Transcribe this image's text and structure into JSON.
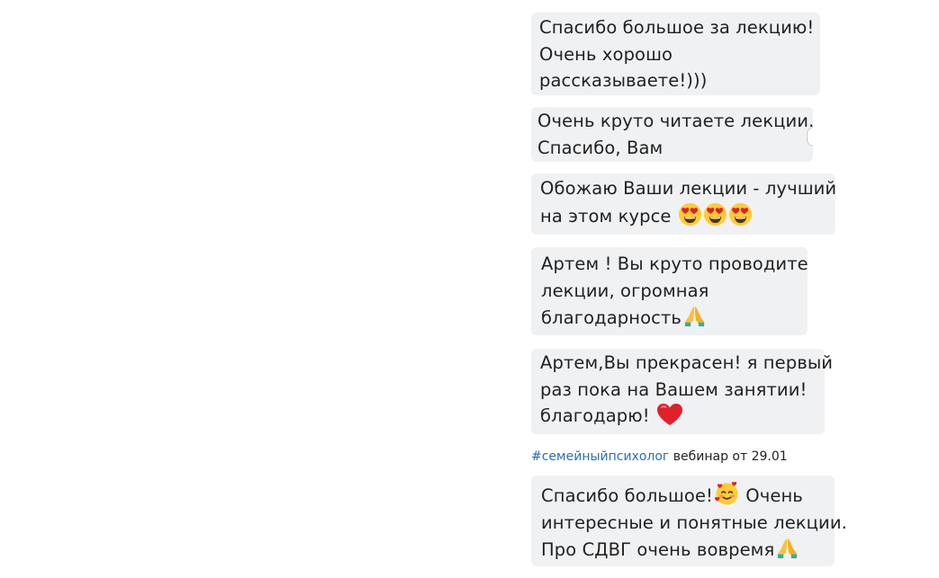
{
  "messages": [
    {
      "lines": [
        "Спасибо большое за лекцию!",
        "Очень хорошо",
        "рассказываете!)))"
      ]
    },
    {
      "lines": [
        "Очень круто читаете лекции.",
        "Спасибо, Вам"
      ]
    },
    {
      "lines": [
        "Обожаю Ваши лекции - лучший",
        "на этом курсе"
      ],
      "emoji": [
        "heart-eyes-icon",
        "heart-eyes-icon",
        "heart-eyes-icon"
      ]
    },
    {
      "lines": [
        "Артем !  Вы круто проводите",
        "лекции, огромная",
        "благодарность"
      ],
      "emoji": [
        "folded-hands-icon"
      ]
    },
    {
      "lines": [
        "Артем,Вы прекрасен! я первый",
        "раз пока на Вашем занятии!",
        "благодарю!"
      ],
      "emoji": [
        "red-heart-icon"
      ]
    },
    {
      "lines": [
        "Спасибо большое!",
        "Очень",
        "интересные и понятные лекции.",
        "Про СДВГ очень вовремя"
      ],
      "emoji": [
        "smiling-face-with-hearts-icon",
        "folded-hands-icon"
      ]
    }
  ],
  "caption": {
    "hashtag": "#семейныйпсихолог",
    "text": " вебинар от 29.01"
  },
  "colors": {
    "bubble_bg": "#f0f1f3",
    "hashtag": "#2a6fb8",
    "heart": "#e0202b",
    "emoji_yellow": "#ffcc33"
  }
}
